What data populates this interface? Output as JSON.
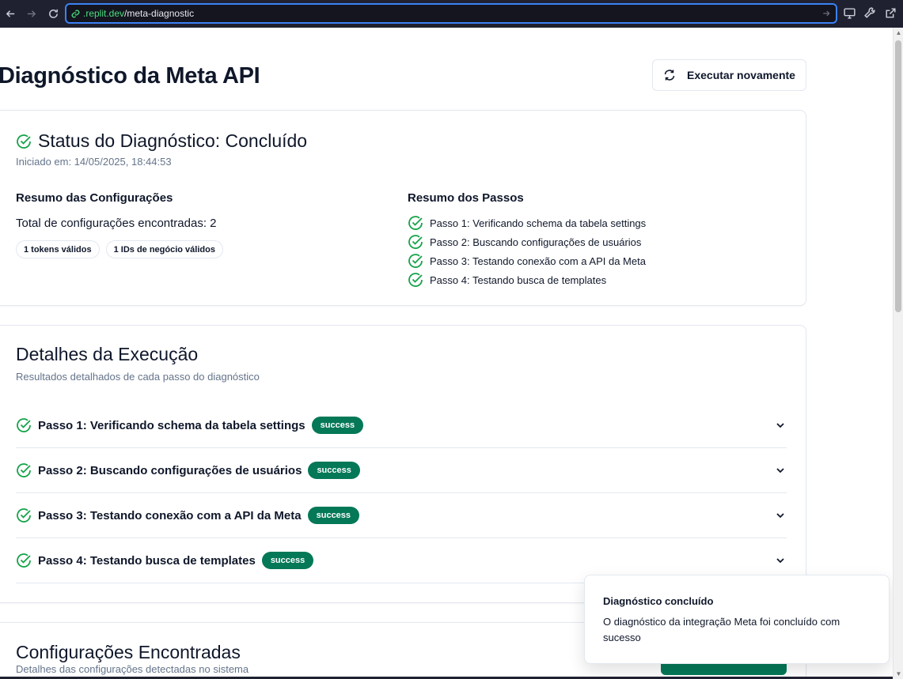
{
  "browser": {
    "url_host": ".replit.dev",
    "url_path": "/meta-diagnostic"
  },
  "header": {
    "title": "Diagnóstico da Meta API",
    "rerun_label": "Executar novamente"
  },
  "status": {
    "title": "Status do Diagnóstico: Concluído",
    "started": "Iniciado em: 14/05/2025, 18:44:53",
    "config_summary_title": "Resumo das Configurações",
    "config_total": "Total de configurações encontradas: 2",
    "badges": [
      "1 tokens válidos",
      "1 IDs de negócio válidos"
    ],
    "steps_summary_title": "Resumo dos Passos",
    "steps_summary": [
      "Passo 1: Verificando schema da tabela settings",
      "Passo 2: Buscando configurações de usuários",
      "Passo 3: Testando conexão com a API da Meta",
      "Passo 4: Testando busca de templates"
    ]
  },
  "details": {
    "title": "Detalhes da Execução",
    "subtitle": "Resultados detalhados de cada passo do diagnóstico",
    "steps": [
      {
        "label": "Passo 1: Verificando schema da tabela settings",
        "status": "success"
      },
      {
        "label": "Passo 2: Buscando configurações de usuários",
        "status": "success"
      },
      {
        "label": "Passo 3: Testando conexão com a API da Meta",
        "status": "success"
      },
      {
        "label": "Passo 4: Testando busca de templates",
        "status": "success"
      }
    ]
  },
  "configs": {
    "title": "Configurações Encontradas",
    "subtitle": "Detalhes das configurações detectadas no sistema"
  },
  "toast": {
    "title": "Diagnóstico concluído",
    "message": "O diagnóstico da integração Meta foi concluído com sucesso"
  },
  "colors": {
    "success": "#16a34a",
    "badge": "#047857",
    "url_focus": "#3b82f6"
  }
}
